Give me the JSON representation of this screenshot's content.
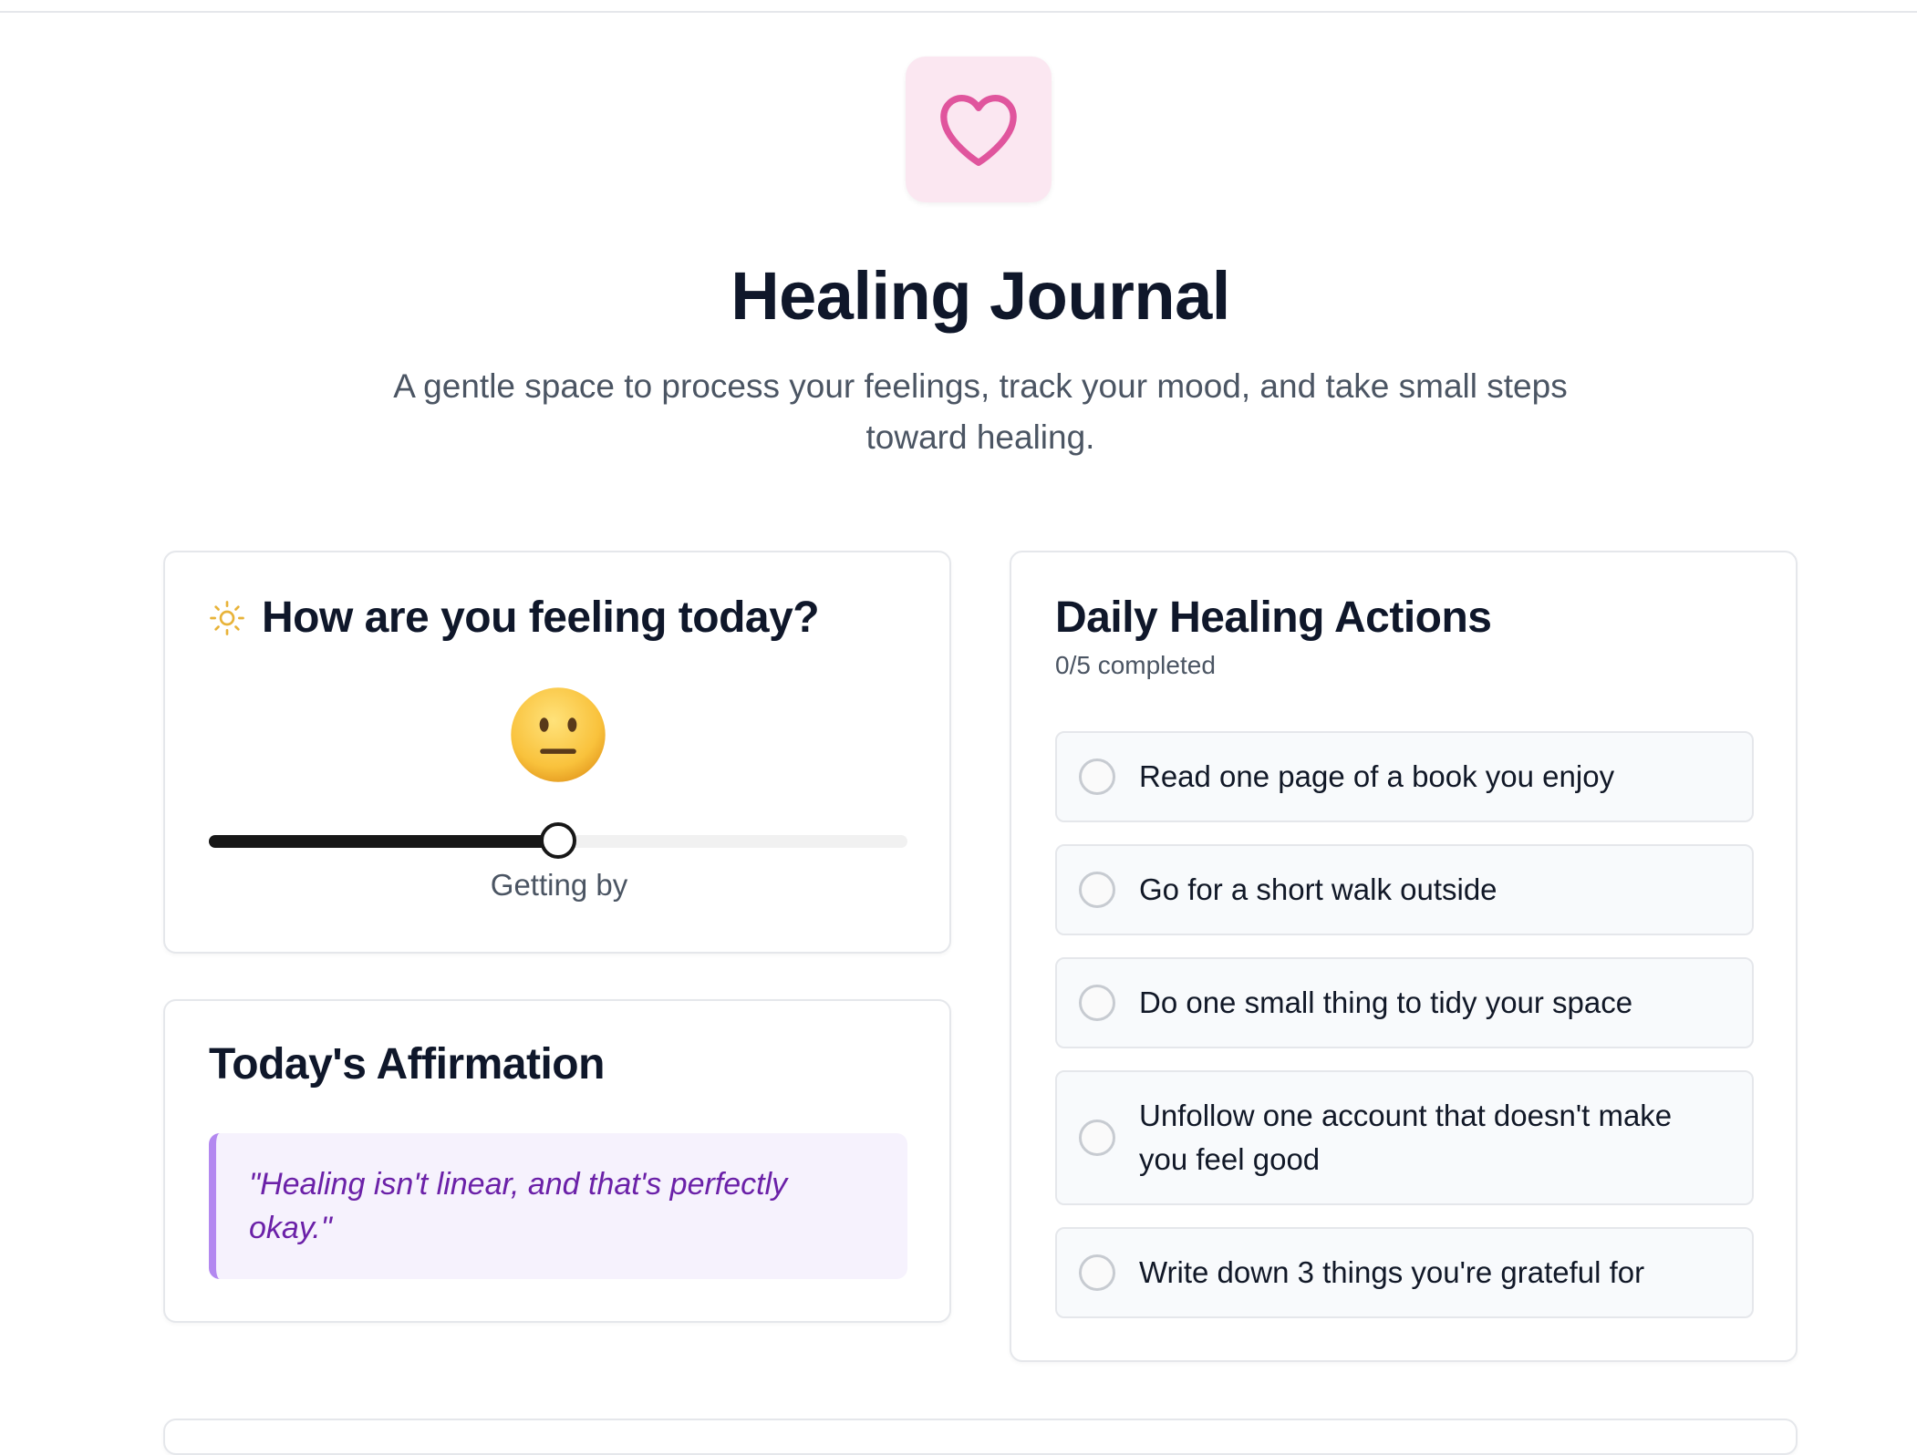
{
  "header": {
    "logo_icon": "heart-icon",
    "title": "Healing Journal",
    "subtitle": "A gentle space to process your feelings, track your mood, and take small steps toward healing."
  },
  "mood": {
    "icon": "sun-icon",
    "title": "How are you feeling today?",
    "emoji": "neutral-face-emoji",
    "slider_value_fraction": 0.5,
    "label": "Getting by"
  },
  "affirmation": {
    "title": "Today's Affirmation",
    "quote": "\"Healing isn't linear, and that's perfectly okay.\""
  },
  "actions": {
    "title": "Daily Healing Actions",
    "completed_text": "0/5 completed",
    "items": [
      {
        "label": "Read one page of a book you enjoy",
        "checked": false
      },
      {
        "label": "Go for a short walk outside",
        "checked": false
      },
      {
        "label": "Do one small thing to tidy your space",
        "checked": false
      },
      {
        "label": "Unfollow one account that doesn't make you feel good",
        "checked": false
      },
      {
        "label": "Write down 3 things you're grateful for",
        "checked": false
      }
    ]
  },
  "colors": {
    "accent_pink": "#e0559d",
    "logo_bg": "#fbe7f1",
    "affirmation_text": "#6b21a8",
    "affirmation_border": "#b388f0",
    "affirmation_bg": "#f6f2fd",
    "sun": "#e8b339"
  }
}
